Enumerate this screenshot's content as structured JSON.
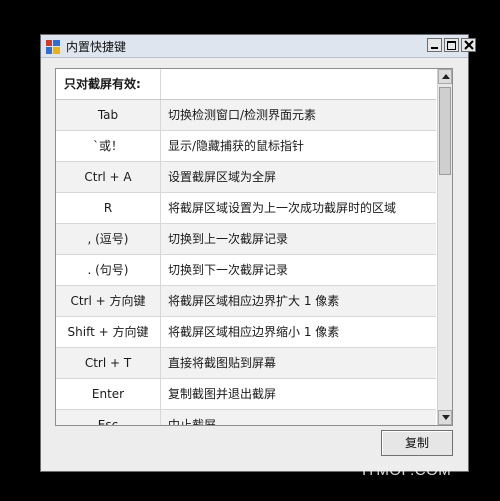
{
  "window": {
    "title": "内置快捷键",
    "controls": [
      "minimize",
      "maximize",
      "close"
    ]
  },
  "table": {
    "header_key": "只对截屏有效:",
    "header_desc": "",
    "rows": [
      {
        "key": "Tab",
        "desc": "切换检测窗口/检测界面元素"
      },
      {
        "key": "`或！",
        "desc": "显示/隐藏捕获的鼠标指针"
      },
      {
        "key": "Ctrl + A",
        "desc": "设置截屏区域为全屏"
      },
      {
        "key": "R",
        "desc": "将截屏区域设置为上一次成功截屏时的区域"
      },
      {
        "key": ", (逗号)",
        "desc": "切换到上一次截屏记录"
      },
      {
        "key": ". (句号)",
        "desc": "切换到下一次截屏记录"
      },
      {
        "key": "Ctrl + 方向键",
        "desc": "将截屏区域相应边界扩大 1 像素"
      },
      {
        "key": "Shift + 方向键",
        "desc": "将截屏区域相应边界缩小 1 像素"
      },
      {
        "key": "Ctrl + T",
        "desc": "直接将截图贴到屏幕"
      },
      {
        "key": "Enter",
        "desc": "复制截图并退出截屏"
      },
      {
        "key": "Esc",
        "desc": "中止截屏"
      }
    ]
  },
  "buttons": {
    "copy_label": "复制"
  },
  "watermark": "ITMOP.COM"
}
